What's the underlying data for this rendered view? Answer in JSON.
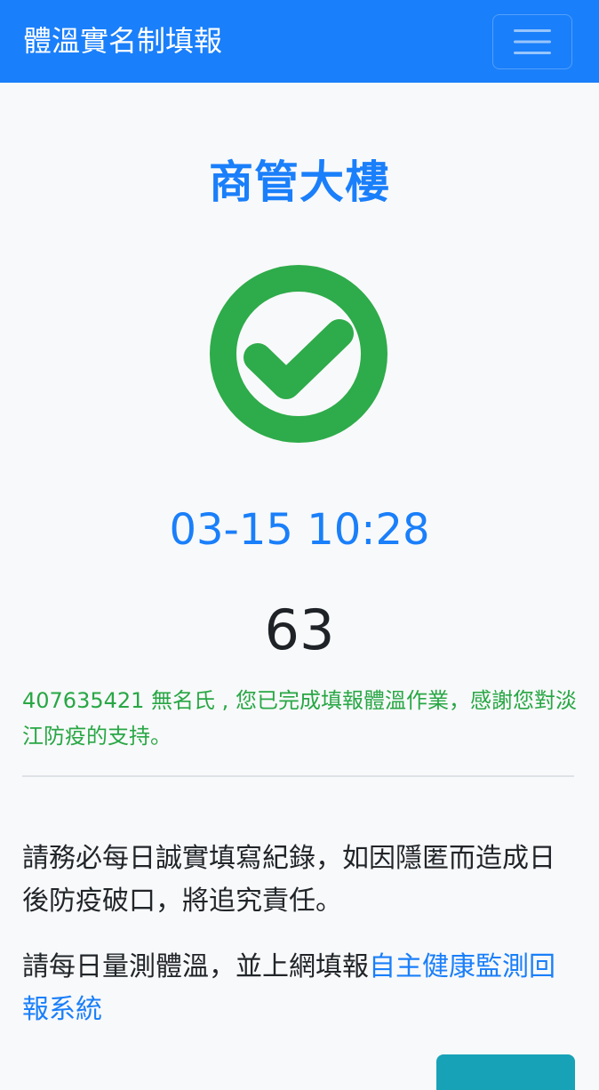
{
  "navbar": {
    "brand": "體溫實名制填報",
    "menu_icon": "hamburger-menu-icon"
  },
  "location": {
    "name": "商管大樓"
  },
  "status": {
    "icon": "check-circle-icon",
    "color": "#2eab4a",
    "datetime": "03-15 10:28",
    "number": "63"
  },
  "message": {
    "success": "407635421 無名氏 , 您已完成填報體溫作業，感謝您對淡江防疫的支持。"
  },
  "notice": {
    "responsibility": "請務必每日誠實填寫紀錄，如因隱匿而造成日後防疫破口，將追究責任。",
    "report_prefix": "請每日量測體溫，並上網填報",
    "report_link": "自主健康監測回報系統"
  },
  "colors": {
    "primary": "#1a7ffa",
    "success_text": "#28a745",
    "info": "#17a2b8"
  }
}
